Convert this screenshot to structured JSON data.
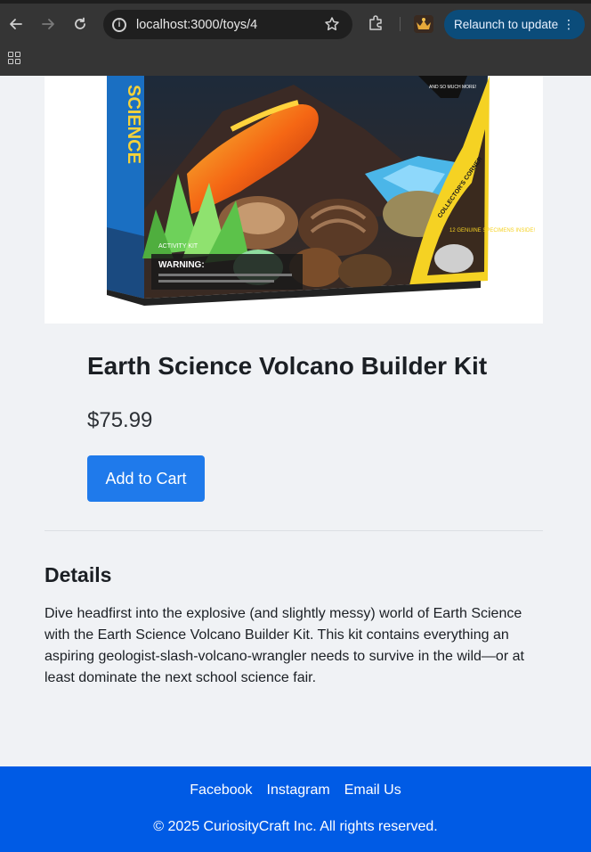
{
  "browser": {
    "url": "localhost:3000/toys/4",
    "relaunch_label": "Relaunch to update",
    "relaunch_color": "#0b4c7a"
  },
  "product": {
    "title": "Earth Science Volcano Builder Kit",
    "price": "$75.99",
    "add_to_cart_label": "Add to Cart",
    "image_alt": "Earth Science Volcano Builder Kit box",
    "box_lettering": {
      "spine": "SCIENCE",
      "warning": "WARNING:",
      "activity": "ACTIVITY KIT",
      "corner": "COLLECTOR'S CORNER",
      "genuine": "12 GENUINE SPECIMENS INSIDE!",
      "badge": "AND SO MUCH MORE!"
    }
  },
  "details": {
    "heading": "Details",
    "text": "Dive headfirst into the explosive (and slightly messy) world of Earth Science with the Earth Science Volcano Builder Kit. This kit contains everything an aspiring geologist-slash-volcano-wrangler needs to survive in the wild—or at least dominate the next school science fair."
  },
  "footer": {
    "links": [
      "Facebook",
      "Instagram",
      "Email Us"
    ],
    "copyright": "© 2025 CuriosityCraft Inc. All rights reserved."
  },
  "colors": {
    "page_bg": "#f0f2f5",
    "button": "#1f7aeb",
    "footer": "#005be5"
  }
}
